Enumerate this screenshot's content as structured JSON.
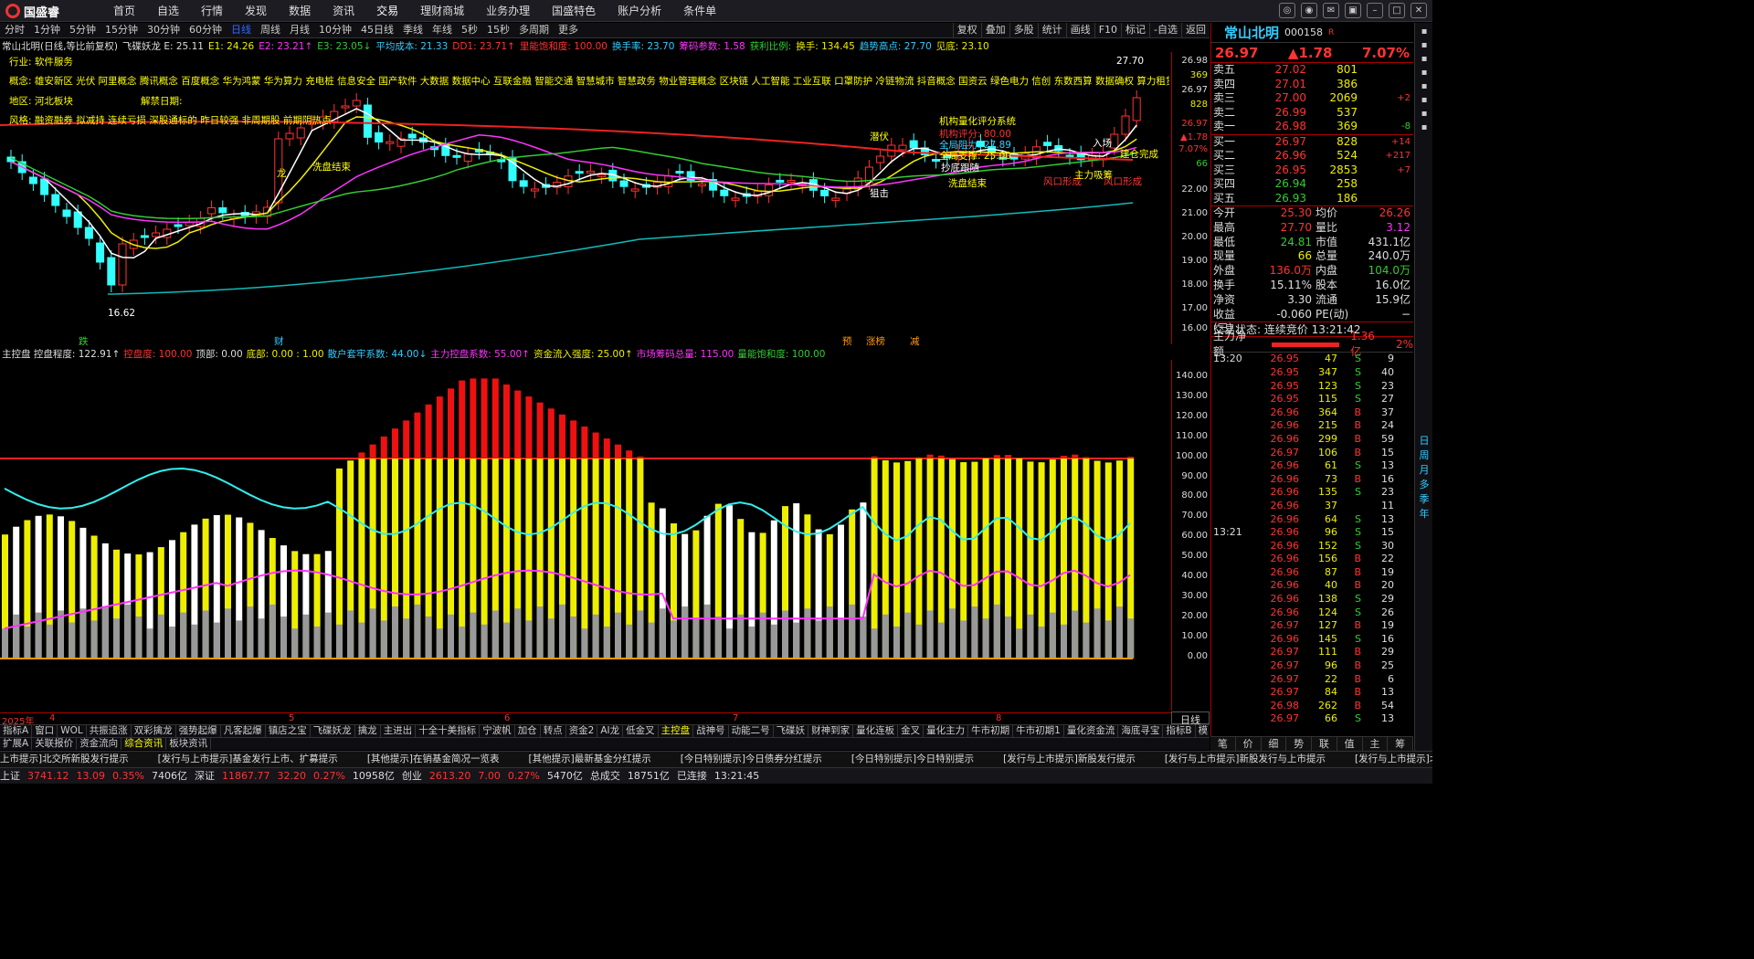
{
  "app": {
    "brand": "国盛睿",
    "menu": [
      "首页",
      "自选",
      "行情",
      "发现",
      "数据",
      "资讯",
      "交易",
      "理财商城",
      "业务办理",
      "国盛特色",
      "账户分析",
      "条件单"
    ]
  },
  "periods": {
    "tabs": [
      "分时",
      "1分钟",
      "5分钟",
      "15分钟",
      "30分钟",
      "60分钟",
      "日线",
      "周线",
      "月线",
      "10分钟",
      "45日线",
      "季线",
      "年线",
      "5秒",
      "15秒",
      "多周期",
      "更多"
    ],
    "active": "日线",
    "tools": [
      "复权",
      "叠加",
      "多股",
      "统计",
      "画线",
      "F10",
      "标记",
      "-自选",
      "返回"
    ]
  },
  "info": [
    {
      "t": "常山北明(日线,等比前复权)",
      "c": "#ddd"
    },
    {
      "t": "飞碟妖龙 E: 25.11",
      "c": "#ddd"
    },
    {
      "t": "E1: 24.26",
      "c": "#ee0"
    },
    {
      "t": "E2: 23.21↑",
      "c": "#f3f"
    },
    {
      "t": "E3: 23.05↓",
      "c": "#3c3"
    },
    {
      "t": "平均成本: 21.33",
      "c": "#3cf"
    },
    {
      "t": "DD1: 23.71↑",
      "c": "#f33"
    },
    {
      "t": "里能饱和度: 100.00",
      "c": "#f33"
    },
    {
      "t": "换手率: 23.70",
      "c": "#3cf"
    },
    {
      "t": "筹码参数: 1.58",
      "c": "#f3f"
    },
    {
      "t": "获利比例:",
      "c": "#3c3"
    },
    {
      "t": "换手: 134.45",
      "c": "#ee0"
    },
    {
      "t": "趋势高点: 27.70",
      "c": "#3cf"
    },
    {
      "t": "见底: 23.10",
      "c": "#ee0"
    }
  ],
  "annotations": {
    "industry": "行业: 软件服务",
    "concepts": "概念: 雄安新区 光伏 阿里概念 腾讯概念 百度概念 华为鸿蒙 华为算力 充电桩 信息安全 国产软件 大数据 数据中心 互联金融 智能交通 智慧城市 智慧政务 物业管理概念 区块链 人工智能 工业互联 口罩防护 冷链物流 抖音概念 国资云 绿色电力 信创 东数西算 数据确权 算力租赁",
    "region": "地区: 河北板块",
    "unlock": "解禁日期:",
    "style": "风格: 融资融券 拟减持 连续亏损 深股通标的 昨日较强 非周期股 前期阴热点",
    "sys": "机构量化评分系统",
    "score": "机构评分: 80.00",
    "press": "全局阻力: 27.89",
    "support": "全局支撑: 25.00",
    "marks": [
      "洗盘结束",
      "洗盘结束",
      "风口形成",
      "风口形成",
      "主力吸筹",
      "建仓完成",
      "潜伏",
      "狙击",
      "抄底跟随",
      "入场",
      "龙"
    ],
    "hi": "27.70",
    "lo": "16.62",
    "bottom": [
      "跌",
      "财",
      "预",
      "涨榜",
      "减"
    ]
  },
  "price_axis": [
    "26.98",
    "369",
    "26.97",
    "828",
    "26.97",
    "▲1.78",
    "7.07%",
    "66",
    "22.00",
    "21.00",
    "20.00",
    "19.00",
    "18.00",
    "17.00",
    "16.00"
  ],
  "indicator": {
    "items": [
      {
        "t": "主控盘 控盘程度: 122.91↑",
        "c": "#ddd"
      },
      {
        "t": "控盘度: 100.00",
        "c": "#f33"
      },
      {
        "t": "顶部: 0.00",
        "c": "#ddd"
      },
      {
        "t": "底部: 0.00 : 1.00",
        "c": "#ee0"
      },
      {
        "t": "散户套牢系数: 44.00↓",
        "c": "#3cf"
      },
      {
        "t": "主力控盘系数: 55.00↑",
        "c": "#f3f"
      },
      {
        "t": "资金流入强度: 25.00↑",
        "c": "#ee0"
      },
      {
        "t": "市场筹码总量: 115.00",
        "c": "#f3f"
      },
      {
        "t": "量能饱和度: 100.00",
        "c": "#3c3"
      }
    ],
    "axis": [
      "140.00",
      "130.00",
      "120.00",
      "110.00",
      "100.00",
      "90.00",
      "80.00",
      "70.00",
      "60.00",
      "50.00",
      "40.00",
      "30.00",
      "20.00",
      "10.00",
      "0.00"
    ]
  },
  "dates": [
    "2025年",
    "4",
    "5",
    "6",
    "7",
    "8"
  ],
  "dayline": "日线",
  "tabs1": [
    "指标A",
    "窗口",
    "WOL",
    "共振追涨",
    "双彩擒龙",
    "强势起爆",
    "凡客起爆",
    "镇店之宝",
    "飞碟妖龙",
    "擒龙",
    "主进出",
    "十全十美指标",
    "宁波帆",
    "加仓",
    "转点",
    "资金2",
    "AI龙",
    "低金叉",
    "主控盘",
    "战神号",
    "动能二号",
    "飞碟妖",
    "财神到家",
    "量化连板",
    "金叉",
    "量化主力",
    "牛市初期",
    "牛市初期1",
    "量化资金流",
    "海底寻宝",
    "指标B",
    "模",
    "板",
    "+",
    "-"
  ],
  "tabs1_active": "主控盘",
  "tabs2": [
    "扩展A",
    "关联报价",
    "资金流向",
    "综合资讯",
    "板块资讯"
  ],
  "tabs2_active": "综合资讯",
  "news": [
    "上市提示]北交所新股发行提示",
    "[发行与上市提示]基金发行上市、扩募提示",
    "[其他提示]在销基金简况一览表",
    "[其他提示]最新基金分红提示",
    "[今日特别提示]今日债券分红提示",
    "[今日特别提示]今日特别提示",
    "[发行与上市提示]新股发行提示",
    "[发行与上市提示]新股发行与上市提示",
    "[发行与上市提示]北交所新股"
  ],
  "status": [
    {
      "t": "上证",
      "c": "#ddd"
    },
    {
      "t": "3741.12",
      "c": "#f33"
    },
    {
      "t": "13.09",
      "c": "#f33"
    },
    {
      "t": "0.35%",
      "c": "#f33"
    },
    {
      "t": "7406亿",
      "c": "#ddd"
    },
    {
      "t": "深证",
      "c": "#ddd"
    },
    {
      "t": "11867.77",
      "c": "#f33"
    },
    {
      "t": "32.20",
      "c": "#f33"
    },
    {
      "t": "0.27%",
      "c": "#f33"
    },
    {
      "t": "10958亿",
      "c": "#ddd"
    },
    {
      "t": "创业",
      "c": "#ddd"
    },
    {
      "t": "2613.20",
      "c": "#f33"
    },
    {
      "t": "7.00",
      "c": "#f33"
    },
    {
      "t": "0.27%",
      "c": "#f33"
    },
    {
      "t": "5470亿",
      "c": "#ddd"
    },
    {
      "t": "总成交",
      "c": "#ddd"
    },
    {
      "t": "18751亿",
      "c": "#ddd"
    },
    {
      "t": "已连接",
      "c": "#ddd"
    },
    {
      "t": "13:21:45",
      "c": "#ddd"
    }
  ],
  "stock": {
    "name": "常山北明",
    "code": "000158",
    "tag": "R",
    "price": "26.97",
    "change": "▲1.78",
    "pct": "7.07%"
  },
  "asks": [
    [
      "卖五",
      "27.02",
      "801",
      ""
    ],
    [
      "卖四",
      "27.01",
      "386",
      ""
    ],
    [
      "卖三",
      "27.00",
      "2069",
      "+2"
    ],
    [
      "卖二",
      "26.99",
      "537",
      ""
    ],
    [
      "卖一",
      "26.98",
      "369",
      "-8"
    ]
  ],
  "bids": [
    [
      "买一",
      "26.97",
      "828",
      "+14"
    ],
    [
      "买二",
      "26.96",
      "524",
      "+217"
    ],
    [
      "买三",
      "26.95",
      "2853",
      "+7"
    ],
    [
      "买四",
      "26.94",
      "258",
      ""
    ],
    [
      "买五",
      "26.93",
      "186",
      ""
    ]
  ],
  "stats": [
    [
      "今开",
      "25.30",
      "均价",
      "26.26"
    ],
    [
      "最高",
      "27.70",
      "量比",
      "3.12"
    ],
    [
      "最低",
      "24.81",
      "市值",
      "431.1亿"
    ],
    [
      "现量",
      "66",
      "总量",
      "240.0万"
    ],
    [
      "外盘",
      "136.0万",
      "内盘",
      "104.0万"
    ],
    [
      "换手",
      "15.11%",
      "股本",
      "16.0亿"
    ],
    [
      "净资",
      "3.30",
      "流通",
      "15.9亿"
    ],
    [
      "收益(三)",
      "-0.060",
      "PE(动)",
      "−"
    ]
  ],
  "tradestate": "交易状态: 连续竞价 13:21:42",
  "netflow": {
    "label": "主力净额",
    "value": "1.36亿",
    "pct": "2%"
  },
  "ticks": [
    [
      "13:20",
      "26.95",
      "47",
      "S",
      "9"
    ],
    [
      "",
      "26.95",
      "347",
      "S",
      "40"
    ],
    [
      "",
      "26.95",
      "123",
      "S",
      "23"
    ],
    [
      "",
      "26.95",
      "115",
      "S",
      "27"
    ],
    [
      "",
      "26.96",
      "364",
      "B",
      "37"
    ],
    [
      "",
      "26.96",
      "215",
      "B",
      "24"
    ],
    [
      "",
      "26.96",
      "299",
      "B",
      "59"
    ],
    [
      "",
      "26.97",
      "106",
      "B",
      "15"
    ],
    [
      "",
      "26.96",
      "61",
      "S",
      "13"
    ],
    [
      "",
      "26.96",
      "73",
      "B",
      "16"
    ],
    [
      "",
      "26.96",
      "135",
      "S",
      "23"
    ],
    [
      "",
      "26.96",
      "37",
      "",
      "11"
    ],
    [
      "",
      "26.96",
      "64",
      "S",
      "13"
    ],
    [
      "13:21",
      "26.96",
      "96",
      "S",
      "15"
    ],
    [
      "",
      "26.96",
      "152",
      "S",
      "30"
    ],
    [
      "",
      "26.96",
      "156",
      "B",
      "22"
    ],
    [
      "",
      "26.96",
      "87",
      "B",
      "19"
    ],
    [
      "",
      "26.96",
      "40",
      "B",
      "20"
    ],
    [
      "",
      "26.96",
      "138",
      "S",
      "29"
    ],
    [
      "",
      "26.96",
      "124",
      "S",
      "26"
    ],
    [
      "",
      "26.97",
      "127",
      "B",
      "19"
    ],
    [
      "",
      "26.96",
      "145",
      "S",
      "16"
    ],
    [
      "",
      "26.97",
      "111",
      "B",
      "29"
    ],
    [
      "",
      "26.97",
      "96",
      "B",
      "25"
    ],
    [
      "",
      "26.97",
      "22",
      "B",
      "6"
    ],
    [
      "",
      "26.97",
      "84",
      "B",
      "13"
    ],
    [
      "",
      "26.98",
      "262",
      "B",
      "54"
    ],
    [
      "",
      "26.97",
      "66",
      "S",
      "13"
    ]
  ],
  "rbot": [
    "笔",
    "价",
    "细",
    "势",
    "联",
    "值",
    "主",
    "筹"
  ],
  "sidebar": [
    "日",
    "周",
    "月",
    "多",
    "季",
    "年"
  ]
}
